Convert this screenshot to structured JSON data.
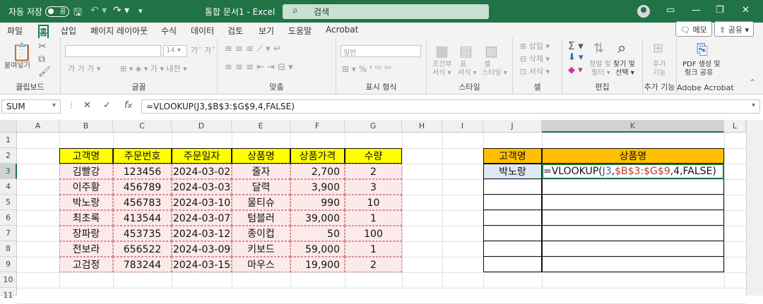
{
  "titlebar": {
    "autosave_label": "자동 저장",
    "autosave_state": "끔",
    "doc_title": "통합 문서1  -  Excel",
    "search_placeholder": "검색"
  },
  "menu": {
    "tabs": [
      "파일",
      "홈",
      "삽입",
      "페이지 레이아웃",
      "수식",
      "데이터",
      "검토",
      "보기",
      "도움말",
      "Acrobat"
    ],
    "active_tab": "홈",
    "memo_button": "메모",
    "share_button": "공유"
  },
  "ribbon": {
    "clipboard": {
      "paste": "붙여넣기",
      "label": "클립보드"
    },
    "font": {
      "size": "14",
      "label": "글꼴"
    },
    "alignment": {
      "label": "맞춤"
    },
    "number": {
      "format": "일반",
      "label": "표시 형식"
    },
    "styles": {
      "conditional": "조건부\n서식",
      "table": "표\n서식",
      "cell": "셀\n스타일",
      "label": "스타일"
    },
    "cells": {
      "insert": "삽입",
      "delete": "삭제",
      "format": "서식",
      "label": "셀"
    },
    "editing": {
      "sort": "정렬 및\n필터",
      "find": "찾기 및\n선택",
      "label": "편집"
    },
    "addins": {
      "label_btn": "추가\n기능",
      "label": "추가 기능"
    },
    "acrobat": {
      "btn": "PDF 생성 및\n링크 공유",
      "label": "Adobe Acrobat"
    }
  },
  "formula_bar": {
    "name_box": "SUM",
    "formula": "=VLOOKUP(J3,$B$3:$G$9,4,FALSE)"
  },
  "sheet": {
    "columns": [
      "A",
      "B",
      "C",
      "D",
      "E",
      "F",
      "G",
      "H",
      "I",
      "J",
      "K",
      "L"
    ],
    "rows": [
      "1",
      "2",
      "3",
      "4",
      "5",
      "6",
      "7",
      "8",
      "9",
      "10",
      "11"
    ],
    "table_headers": [
      "고객명",
      "주문번호",
      "주문일자",
      "상품명",
      "상품가격",
      "수량"
    ],
    "table_rows": [
      [
        "김빨강",
        "123456",
        "2024-03-02",
        "줄자",
        "2,700",
        "2"
      ],
      [
        "이주황",
        "456789",
        "2024-03-03",
        "달력",
        "3,900",
        "3"
      ],
      [
        "박노랑",
        "456783",
        "2024-03-10",
        "물티슈",
        "990",
        "10"
      ],
      [
        "최초록",
        "413544",
        "2024-03-07",
        "텀블러",
        "39,000",
        "1"
      ],
      [
        "장파랑",
        "453735",
        "2024-03-12",
        "종이컵",
        "50",
        "100"
      ],
      [
        "전보라",
        "656522",
        "2024-03-09",
        "키보드",
        "59,000",
        "1"
      ],
      [
        "고검정",
        "783244",
        "2024-03-15",
        "마우스",
        "19,900",
        "2"
      ]
    ],
    "lookup_headers": [
      "고객명",
      "상품명"
    ],
    "lookup_value": "박노랑",
    "lookup_formula": {
      "prefix": "=VLOOKUP(",
      "ref1": "J3",
      "sep1": ",",
      "ref2": "$B$3:$G$9",
      "suffix": ",4,FALSE)"
    }
  }
}
